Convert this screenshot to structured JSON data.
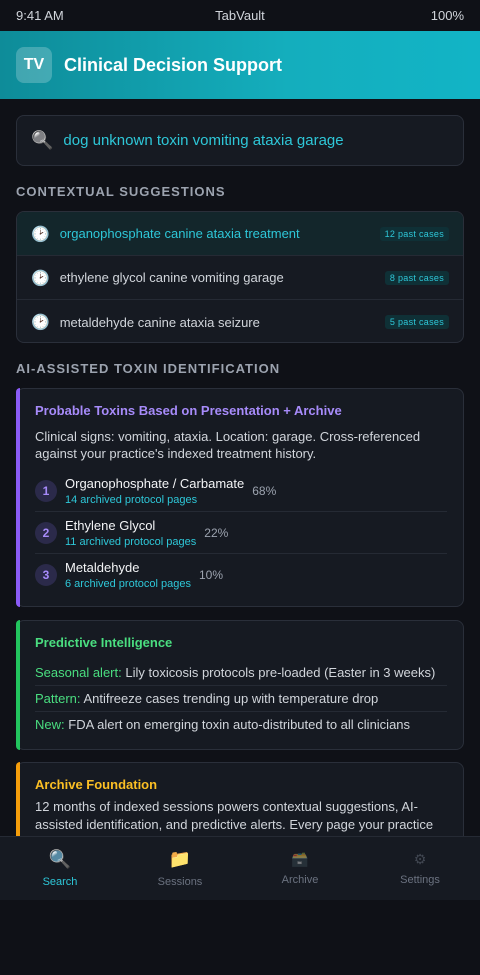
{
  "statusbar": {
    "time": "9:41 AM",
    "app": "TabVault",
    "battery": "100%"
  },
  "header": {
    "logo": "TV",
    "title": "Clinical Decision Support"
  },
  "search": {
    "icon": "search-icon",
    "query": "dog unknown toxin vomiting ataxia garage"
  },
  "suggestions": {
    "heading": "CONTEXTUAL SUGGESTIONS",
    "items": [
      {
        "text": "organophosphate canine ataxia treatment",
        "badge": "12 past cases",
        "active": true
      },
      {
        "text": "ethylene glycol canine vomiting garage",
        "badge": "8 past cases"
      },
      {
        "text": "metaldehyde canine ataxia seizure",
        "badge": "5 past cases"
      }
    ]
  },
  "toxid": {
    "heading": "AI-ASSISTED TOXIN IDENTIFICATION",
    "title": "Probable Toxins Based on Presentation + Archive",
    "desc": "Clinical signs: vomiting, ataxia. Location: garage. Cross-referenced against your practice's indexed treatment history.",
    "toxins": [
      {
        "rank": "1",
        "name": "Organophosphate / Carbamate",
        "sub": "14 archived protocol pages",
        "pct": "68%"
      },
      {
        "rank": "2",
        "name": "Ethylene Glycol",
        "sub": "11 archived protocol pages",
        "pct": "22%"
      },
      {
        "rank": "3",
        "name": "Metaldehyde",
        "sub": "6 archived protocol pages",
        "pct": "10%"
      }
    ]
  },
  "predictive": {
    "title": "Predictive Intelligence",
    "rows": [
      {
        "key": "Seasonal alert:",
        "val": "Lily toxicosis protocols pre-loaded (Easter in 3 weeks)"
      },
      {
        "key": "Pattern:",
        "val": "Antifreeze cases trending up with temperature drop"
      },
      {
        "key": "New:",
        "val": "FDA alert on emerging toxin auto-distributed to all clinicians"
      }
    ]
  },
  "archive": {
    "title": "Archive Foundation",
    "desc": "12 months of indexed sessions powers contextual suggestions, AI-assisted identification, and predictive alerts. Every page your practice"
  },
  "tabs": [
    {
      "label": "Search",
      "icon": "search-icon",
      "glyph": "🔍",
      "active": true
    },
    {
      "label": "Sessions",
      "icon": "folder-icon",
      "glyph": "📁"
    },
    {
      "label": "Archive",
      "icon": "archive-box-icon",
      "glyph": "🗃️"
    },
    {
      "label": "Settings",
      "icon": "gear-icon",
      "glyph": "⚙"
    }
  ],
  "colors": {
    "accent": "#2ec7d8",
    "purple": "#a78bfa",
    "green": "#4ade80",
    "orange": "#fbbf24"
  }
}
